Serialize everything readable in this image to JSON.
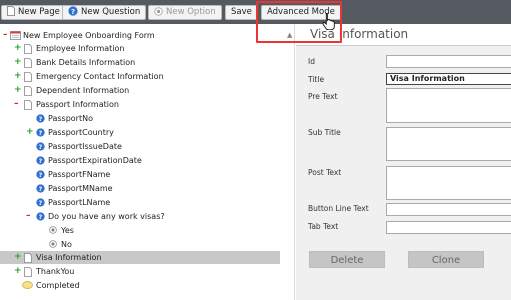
{
  "toolbar": {
    "new_page": "New Page",
    "new_question": "New Question",
    "new_option": "New Option",
    "save": "Save",
    "advanced_mode": "Advanced Mode"
  },
  "tree": {
    "form_title": "New Employee Onboarding Form",
    "pages": {
      "employee_information": "Employee Information",
      "bank_details": "Bank Details Information",
      "emergency_contact": "Emergency Contact Information",
      "dependent": "Dependent Information",
      "passport": "Passport Information",
      "visa": "Visa Information",
      "thankyou": "ThankYou"
    },
    "passport_questions": [
      "PassportNo",
      "PassportCountry",
      "PassportIssueDate",
      "PassportExpirationDate",
      "PassportFName",
      "PassportMName",
      "PassportLName",
      "Do you have any work visas?"
    ],
    "options": [
      "Yes",
      "No"
    ],
    "completed": "Completed"
  },
  "panel": {
    "title": "Visa Information",
    "labels": {
      "id": "Id",
      "title": "Title",
      "pre_text": "Pre Text",
      "sub_title": "Sub Title",
      "post_text": "Post Text",
      "button_line_text": "Button Line Text",
      "tab_text": "Tab Text"
    },
    "values": {
      "id": "",
      "title": "Visa Information"
    },
    "delete_label": "Delete",
    "clone_label": "Clone"
  },
  "colors": {
    "toolbar_bg": "#555a60",
    "highlight_box": "#e33333",
    "selected_row": "#c8c8c8",
    "question_icon": "#2f6fd0",
    "expand_plus": "#2aa02a",
    "collapse_minus": "#dd2222"
  }
}
